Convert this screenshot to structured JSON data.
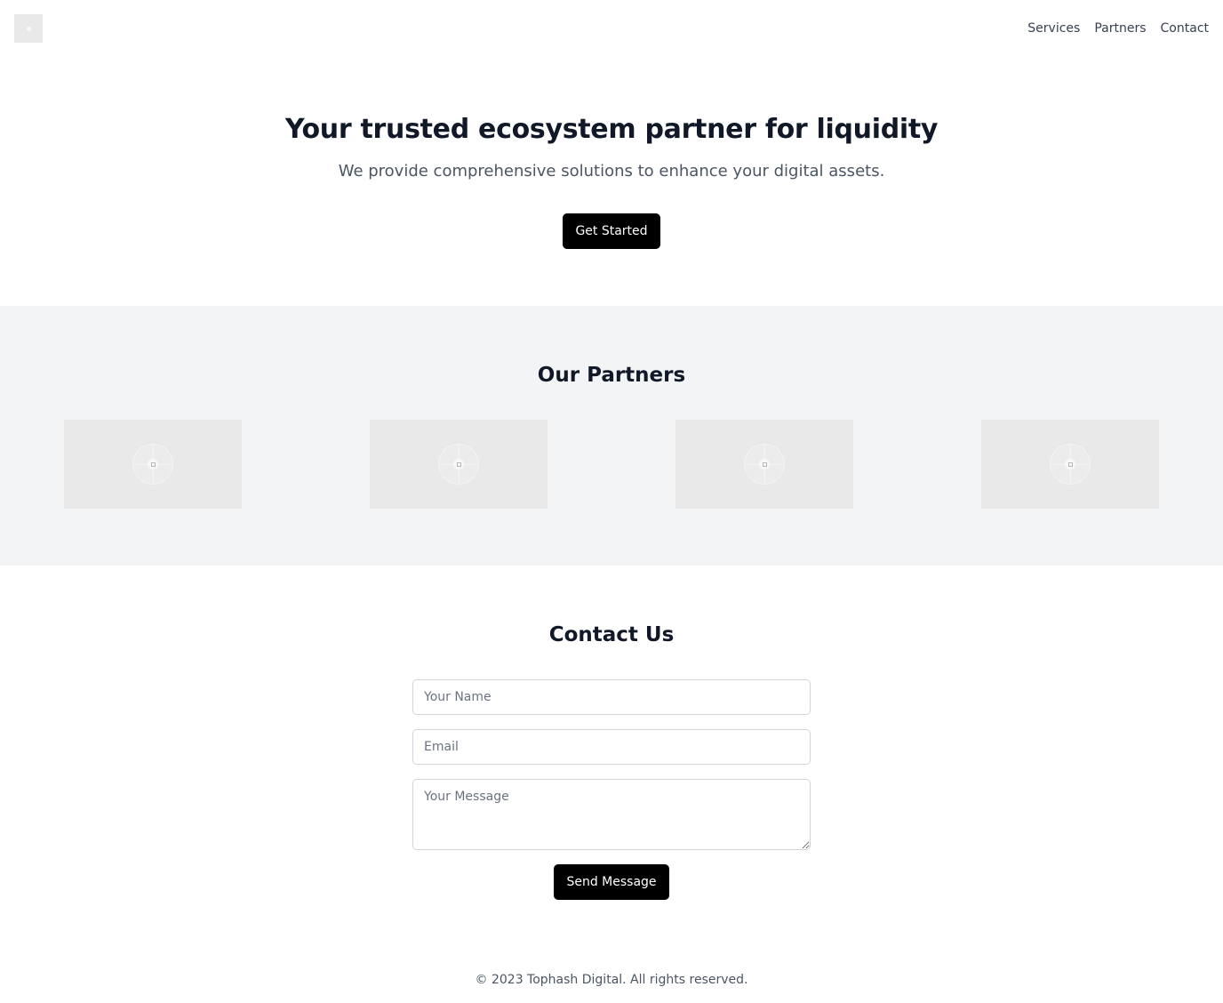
{
  "header": {
    "nav": [
      "Services",
      "Partners",
      "Contact"
    ]
  },
  "hero": {
    "title": "Your trusted ecosystem partner for liquidity",
    "subtitle": "We provide comprehensive solutions to enhance your digital assets.",
    "cta_label": "Get Started"
  },
  "partners": {
    "title": "Our Partners",
    "logos": [
      "image-placeholder-icon",
      "image-placeholder-icon",
      "image-placeholder-icon",
      "image-placeholder-icon"
    ]
  },
  "contact": {
    "title": "Contact Us",
    "name_placeholder": "Your Name",
    "email_placeholder": "Email",
    "message_placeholder": "Your Message",
    "name_value": "",
    "email_value": "",
    "message_value": "",
    "submit_label": "Send Message"
  },
  "footer": {
    "copyright": "© 2023 Tophash Digital. All rights reserved."
  },
  "colors": {
    "primary_button": "#000000",
    "partners_background": "#f2f4f6",
    "heading": "#111827"
  }
}
